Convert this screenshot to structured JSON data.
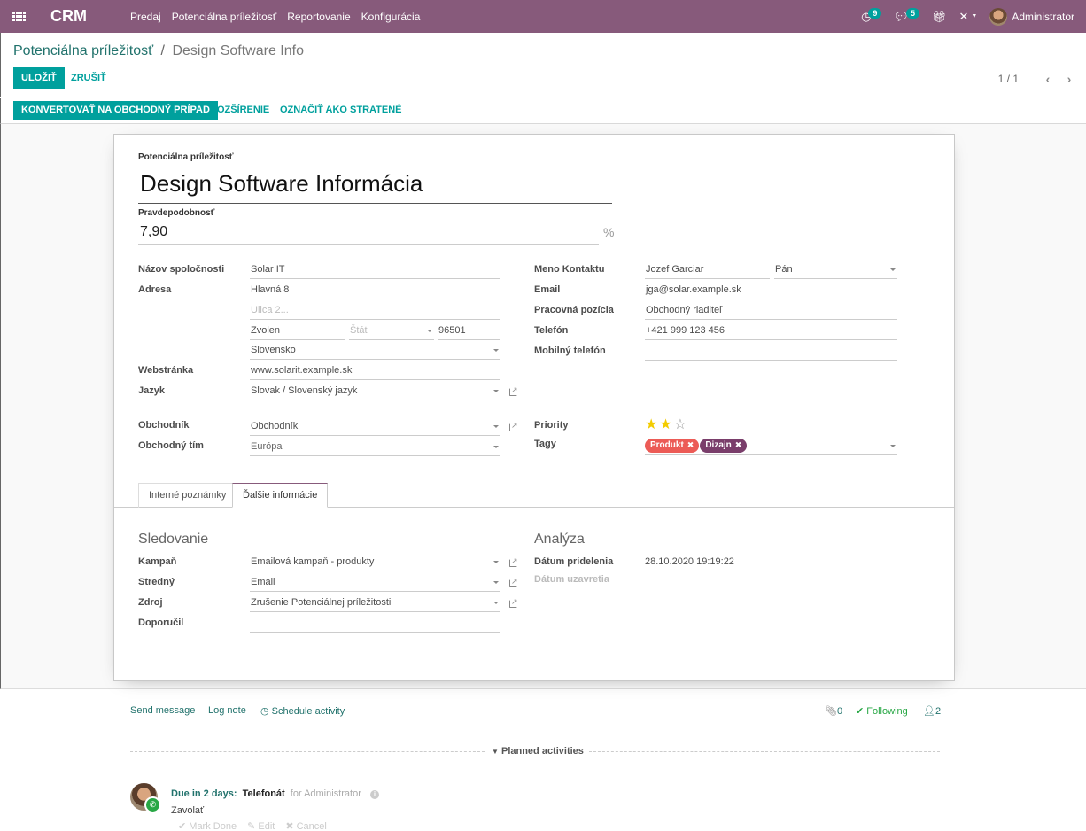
{
  "navbar": {
    "app_name": "CRM",
    "menu": [
      "Predaj",
      "Potenciálna príležitosť",
      "Reportovanie",
      "Konfigurácia"
    ],
    "activity_count": "9",
    "message_count": "5",
    "user": "Administrator",
    "brand_color": "#875a7b"
  },
  "control": {
    "breadcrumb_parent": "Potenciálna príležitosť",
    "breadcrumb_sep": "/",
    "breadcrumb_current": "Design Software Info",
    "save_label": "ULOŽIŤ",
    "discard_label": "ZRUŠIŤ",
    "pager_value": "1 / 1",
    "pager_prev": "‹",
    "pager_next": "›"
  },
  "statusbar": {
    "convert_label": "KONVERTOVAŤ NA OBCHODNÝ PRÍPAD",
    "enrich_label": "ROZŠÍRENIE",
    "mark_lost_label": "OZNAČIŤ AKO STRATENÉ",
    "accent_color": "#00a09d"
  },
  "form": {
    "title_label": "Potenciálna príležitosť",
    "title_value": "Design Software Informácia",
    "probability_label": "Pravdepodobnosť",
    "probability_value": "7,90",
    "probability_unit": "%",
    "left": {
      "company_label": "Názov spoločnosti",
      "company_value": "Solar IT",
      "address_label": "Adresa",
      "street": "Hlavná 8",
      "street2_placeholder": "Ulica 2...",
      "city": "Zvolen",
      "state_placeholder": "Štát",
      "zip": "96501",
      "country": "Slovensko",
      "website_label": "Webstránka",
      "website_value": "www.solarit.example.sk",
      "language_label": "Jazyk",
      "language_value": "Slovak / Slovenský jazyk",
      "salesperson_label": "Obchodník",
      "salesperson_value": "Obchodník",
      "team_label": "Obchodný tím",
      "team_value": "Európa"
    },
    "right": {
      "contact_label": "Meno Kontaktu",
      "contact_value": "Jozef Garciar",
      "title_value": "Pán",
      "email_label": "Email",
      "email_value": "jga@solar.example.sk",
      "job_label": "Pracovná pozícia",
      "job_value": "Obchodný riaditeľ",
      "phone_label": "Telefón",
      "phone_value": "+421 999 123 456",
      "mobile_label": "Mobilný telefón",
      "mobile_value": "",
      "priority_label": "Priority",
      "priority_value": 2,
      "priority_max": 3,
      "tags_label": "Tagy",
      "tags": [
        {
          "label": "Produkt",
          "color": "#ec5b56"
        },
        {
          "label": "Dizajn",
          "color": "#7a3e6b"
        }
      ]
    },
    "tabs": [
      "Interné poznámky",
      "Ďalšie informácie"
    ],
    "active_tab": 1,
    "tracking": {
      "title": "Sledovanie",
      "campaign_label": "Kampaň",
      "campaign_value": "Emailová kampaň - produkty",
      "medium_label": "Stredný",
      "medium_value": "Email",
      "source_label": "Zdroj",
      "source_value": "Zrušenie Potenciálnej príležitosti",
      "referred_label": "Doporučil",
      "referred_value": ""
    },
    "analysis": {
      "title": "Analýza",
      "assign_label": "Dátum pridelenia",
      "assign_value": "28.10.2020 19:19:22",
      "close_label": "Dátum uzavretia"
    }
  },
  "chatter": {
    "send_message": "Send message",
    "log_note": "Log note",
    "schedule_activity": "Schedule activity",
    "attachments": "0",
    "following": "Following",
    "followers": "2",
    "planned_label": "Planned activities",
    "activity": {
      "due": "Due in 2 days:",
      "type": "Telefonát",
      "for": "for Administrator",
      "summary": "Zavolať",
      "mark_done": "Mark Done",
      "edit": "Edit",
      "cancel": "Cancel"
    }
  }
}
